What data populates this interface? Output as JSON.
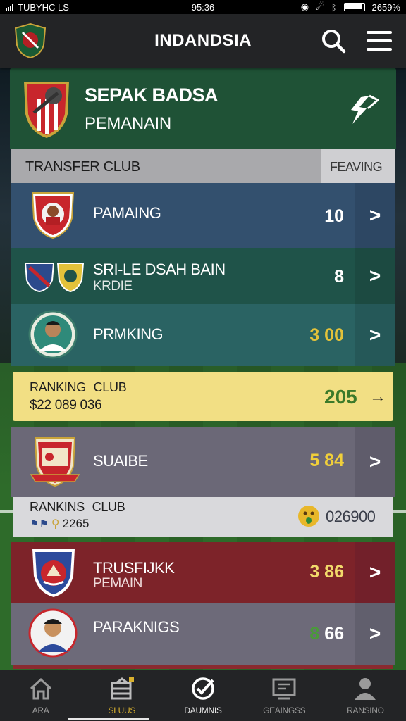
{
  "status_bar": {
    "carrier": "TUBYHC LS",
    "time": "95:36",
    "battery": "2659%"
  },
  "header": {
    "title": "INDANDSIA"
  },
  "hero": {
    "title": "SEPAK BADSA",
    "subtitle": "PEMANAIN"
  },
  "tabs": {
    "left": "TRANSFER CLUB",
    "right": "FEAVING"
  },
  "rows": [
    {
      "name": "PAMAING",
      "sub": "",
      "value": "10",
      "value_color": "#ffffff"
    },
    {
      "name": "SRI-LE DSAH BAIN",
      "sub": "KRDIE",
      "value": "8",
      "value_color": "#ffffff"
    },
    {
      "name": "PRMKING",
      "sub": "",
      "value": "3 00",
      "value_color": "#e3c23a"
    },
    {
      "name": "SUAIBE",
      "sub": "",
      "value": "5 84",
      "value_color": "#f0cf3a"
    },
    {
      "name": "TRUSFIJKK",
      "sub": "PEMAIN",
      "value": "3 86",
      "value_color": "#f2d96b"
    },
    {
      "name": "PARAKNIGS",
      "sub": "",
      "value": "66",
      "value_prefix": "8",
      "value_color": "#ffffff"
    }
  ],
  "ranking_yellow": {
    "label1": "RANKING CLUB",
    "line2": "$22 089 036",
    "value": "205",
    "arrow": "→"
  },
  "ranking_gray": {
    "label1": "RANKINS CLUB",
    "line2": "2265",
    "value": "026900"
  },
  "bottom_nav": [
    {
      "label": "ARA",
      "icon": "home-icon"
    },
    {
      "label": "SLUUS",
      "icon": "clubs-icon"
    },
    {
      "label": "DAUMNIS",
      "icon": "check-icon"
    },
    {
      "label": "GEAINGSS",
      "icon": "tv-icon"
    },
    {
      "label": "RANSINO",
      "icon": "user-icon"
    }
  ],
  "colors": {
    "hero_green": "#1f5236",
    "ranking_yellow": "#f2df84",
    "accent_gold": "#d9b12e",
    "red_row": "#7d2329"
  }
}
